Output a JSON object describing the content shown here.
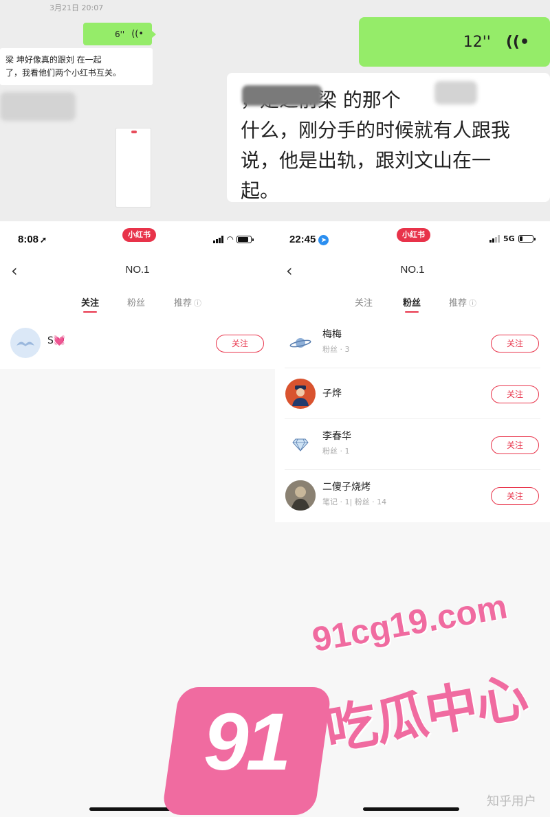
{
  "chat": {
    "timestamp": "3月21日 20:07",
    "voice_small": {
      "duration": "6''"
    },
    "voice_large": {
      "duration": "12''"
    },
    "msg_small": {
      "line1": "梁  坤好像真的跟刘    在一起",
      "line2": "了，我看他们两个小红书互关。"
    },
    "msg_large": {
      "line1": "         ，是之前梁      的那个",
      "line2": "什么，刚分手的时候就有人跟我",
      "line3": "说，他是出轨，跟刘文山在一",
      "line4": "起。"
    }
  },
  "left_phone": {
    "status": {
      "time": "8:08"
    },
    "app_badge": "小红书",
    "nav": {
      "title": "NO.1"
    },
    "tabs": [
      "关注",
      "粉丝",
      "推荐"
    ],
    "active_tab": 0,
    "users": [
      {
        "name": "S💓",
        "meta": "",
        "follow_label": "关注",
        "avatar_color": "#dbe8f7"
      }
    ]
  },
  "right_phone": {
    "status": {
      "time": "22:45",
      "network": "5G"
    },
    "app_badge": "小红书",
    "nav": {
      "title": "NO.1"
    },
    "tabs": [
      "关注",
      "粉丝",
      "推荐"
    ],
    "active_tab": 1,
    "users": [
      {
        "name": "梅梅",
        "meta": "粉丝 · 3",
        "follow_label": "关注",
        "avatar_icon": "planet-icon"
      },
      {
        "name": "子烨",
        "meta": "",
        "follow_label": "关注",
        "avatar_icon": "person-icon"
      },
      {
        "name": "李春华",
        "meta": "粉丝 · 1",
        "follow_label": "关注",
        "avatar_icon": "diamond-icon"
      },
      {
        "name": "二傻子烧烤",
        "meta": "笔记 · 1| 粉丝 · 14",
        "follow_label": "关注",
        "avatar_icon": "photo-icon"
      }
    ]
  },
  "watermark": {
    "number": "91",
    "domain": "91cg19.com",
    "title": "吃瓜中心"
  },
  "credit": "知乎用户",
  "colors": {
    "accent": "#e8334a",
    "wechat_green": "#95ec69",
    "watermark_pink": "#f06ba0"
  }
}
